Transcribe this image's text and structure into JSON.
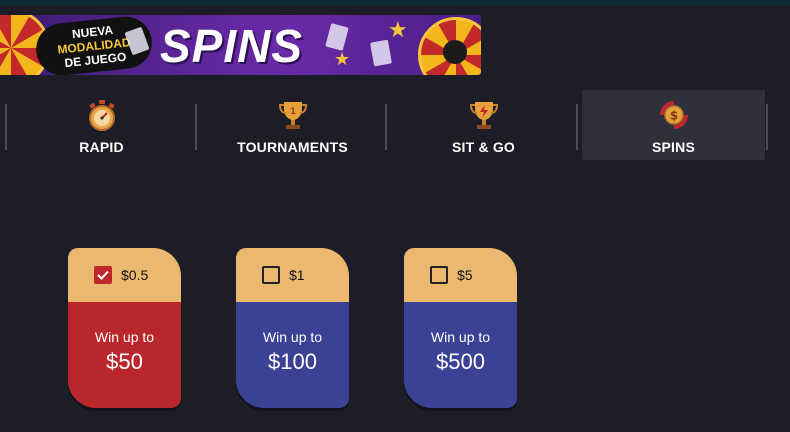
{
  "banner": {
    "badge_line1": "NUEVA",
    "badge_line2": "MODALIDAD",
    "badge_line3": "DE JUEGO",
    "title": "SPINS"
  },
  "tabs": [
    {
      "label": "RAPID",
      "icon": "stopwatch-icon"
    },
    {
      "label": "TOURNAMENTS",
      "icon": "trophy-icon"
    },
    {
      "label": "SIT & GO",
      "icon": "lightning-trophy-icon"
    },
    {
      "label": "SPINS",
      "icon": "spin-coin-icon",
      "active": true
    }
  ],
  "spin_options": [
    {
      "buyin": "$0.5",
      "win_label": "Win up to",
      "prize": "$50",
      "selected": true,
      "color": "#b9272d"
    },
    {
      "buyin": "$1",
      "win_label": "Win up to",
      "prize": "$100",
      "selected": false,
      "color": "#3b4296"
    },
    {
      "buyin": "$5",
      "win_label": "Win up to",
      "prize": "$500",
      "selected": false,
      "color": "#3b4296"
    }
  ],
  "colors": {
    "background": "#1c1d26",
    "active_tab": "#2f303b",
    "card_header": "#ebb870",
    "checkbox_checked": "#c0282e"
  }
}
